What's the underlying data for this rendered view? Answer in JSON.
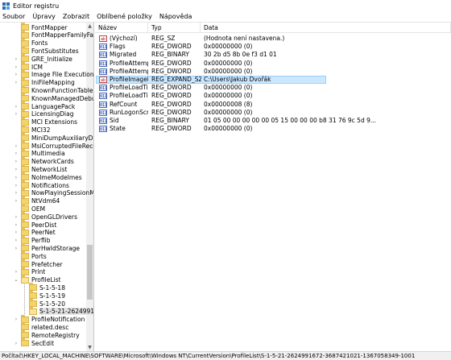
{
  "window": {
    "title": "Editor registru"
  },
  "menu": [
    "Soubor",
    "Úpravy",
    "Zobrazit",
    "Oblíbené položky",
    "Nápověda"
  ],
  "tree": [
    {
      "label": "FontMapper",
      "twisty": "",
      "folder": "closed"
    },
    {
      "label": "FontMapperFamilyFa",
      "twisty": "",
      "folder": "closed"
    },
    {
      "label": "Fonts",
      "twisty": "",
      "folder": "closed"
    },
    {
      "label": "FontSubstitutes",
      "twisty": "",
      "folder": "closed"
    },
    {
      "label": "GRE_Initialize",
      "twisty": ">",
      "folder": "closed"
    },
    {
      "label": "ICM",
      "twisty": ">",
      "folder": "closed"
    },
    {
      "label": "Image File Execution (",
      "twisty": ">",
      "folder": "closed"
    },
    {
      "label": "IniFileMapping",
      "twisty": ">",
      "folder": "closed"
    },
    {
      "label": "KnownFunctionTable",
      "twisty": "",
      "folder": "closed"
    },
    {
      "label": "KnownManagedDebu",
      "twisty": "",
      "folder": "closed"
    },
    {
      "label": "LanguagePack",
      "twisty": ">",
      "folder": "closed"
    },
    {
      "label": "LicensingDiag",
      "twisty": ">",
      "folder": "closed"
    },
    {
      "label": "MCI Extensions",
      "twisty": "",
      "folder": "closed"
    },
    {
      "label": "MCI32",
      "twisty": "",
      "folder": "closed"
    },
    {
      "label": "MiniDumpAuxiliaryDl",
      "twisty": "",
      "folder": "closed"
    },
    {
      "label": "MsiCorruptedFileReco",
      "twisty": ">",
      "folder": "closed"
    },
    {
      "label": "Multimedia",
      "twisty": ">",
      "folder": "closed"
    },
    {
      "label": "NetworkCards",
      "twisty": ">",
      "folder": "closed"
    },
    {
      "label": "NetworkList",
      "twisty": ">",
      "folder": "closed"
    },
    {
      "label": "NoImeModelmes",
      "twisty": ">",
      "folder": "closed"
    },
    {
      "label": "Notifications",
      "twisty": ">",
      "folder": "closed"
    },
    {
      "label": "NowPlayingSessionM",
      "twisty": ">",
      "folder": "closed"
    },
    {
      "label": "NtVdm64",
      "twisty": ">",
      "folder": "closed"
    },
    {
      "label": "OEM",
      "twisty": "",
      "folder": "closed"
    },
    {
      "label": "OpenGLDrivers",
      "twisty": ">",
      "folder": "closed"
    },
    {
      "label": "PeerDist",
      "twisty": ">",
      "folder": "closed"
    },
    {
      "label": "PeerNet",
      "twisty": ">",
      "folder": "closed"
    },
    {
      "label": "Perflib",
      "twisty": ">",
      "folder": "closed"
    },
    {
      "label": "PerHwIdStorage",
      "twisty": ">",
      "folder": "closed"
    },
    {
      "label": "Ports",
      "twisty": "",
      "folder": "closed"
    },
    {
      "label": "Prefetcher",
      "twisty": "",
      "folder": "closed"
    },
    {
      "label": "Print",
      "twisty": ">",
      "folder": "closed"
    },
    {
      "label": "ProfileList",
      "twisty": "v",
      "folder": "open"
    },
    {
      "label": "S-1-5-18",
      "twisty": "",
      "folder": "closed",
      "indent": 1
    },
    {
      "label": "S-1-5-19",
      "twisty": "",
      "folder": "closed",
      "indent": 1
    },
    {
      "label": "S-1-5-20",
      "twisty": "",
      "folder": "closed",
      "indent": 1
    },
    {
      "label": "S-1-5-21-2624991",
      "twisty": "",
      "folder": "open",
      "indent": 1,
      "selected": true
    },
    {
      "label": "ProfileNotification",
      "twisty": ">",
      "folder": "closed"
    },
    {
      "label": "related.desc",
      "twisty": "",
      "folder": "closed"
    },
    {
      "label": "RemoteRegistry",
      "twisty": "",
      "folder": "closed"
    },
    {
      "label": "SecEdit",
      "twisty": ">",
      "folder": "closed"
    }
  ],
  "columns": {
    "name": "Název",
    "type": "Typ",
    "data": "Data"
  },
  "values": [
    {
      "name": "(Výchozí)",
      "type": "REG_SZ",
      "data": "(Hodnota není nastavena.)",
      "icon": "ab"
    },
    {
      "name": "Flags",
      "type": "REG_DWORD",
      "data": "0x00000000 (0)",
      "icon": "bin"
    },
    {
      "name": "Migrated",
      "type": "REG_BINARY",
      "data": "30 2b d5 8b 0e f3 d1 01",
      "icon": "bin"
    },
    {
      "name": "ProfileAttempte...",
      "type": "REG_DWORD",
      "data": "0x00000000 (0)",
      "icon": "bin"
    },
    {
      "name": "ProfileAttempte...",
      "type": "REG_DWORD",
      "data": "0x00000000 (0)",
      "icon": "bin"
    },
    {
      "name": "ProfileImagePath",
      "type": "REG_EXPAND_SZ",
      "data": "C:\\Users\\Jakub Dvořák",
      "icon": "ab",
      "selected": true
    },
    {
      "name": "ProfileLoadTim...",
      "type": "REG_DWORD",
      "data": "0x00000000 (0)",
      "icon": "bin"
    },
    {
      "name": "ProfileLoadTim...",
      "type": "REG_DWORD",
      "data": "0x00000000 (0)",
      "icon": "bin"
    },
    {
      "name": "RefCount",
      "type": "REG_DWORD",
      "data": "0x00000008 (8)",
      "icon": "bin"
    },
    {
      "name": "RunLogonScript...",
      "type": "REG_DWORD",
      "data": "0x00000000 (0)",
      "icon": "bin"
    },
    {
      "name": "Sid",
      "type": "REG_BINARY",
      "data": "01 05 00 00 00 00 00 05 15 00 00 00 b8 31 76 9c 5d 9...",
      "icon": "bin"
    },
    {
      "name": "State",
      "type": "REG_DWORD",
      "data": "0x00000000 (0)",
      "icon": "bin"
    }
  ],
  "status": {
    "path": "Počítač\\HKEY_LOCAL_MACHINE\\SOFTWARE\\Microsoft\\Windows NT\\CurrentVersion\\ProfileList\\S-1-5-21-2624991672-3687421021-1367058349-1001"
  }
}
